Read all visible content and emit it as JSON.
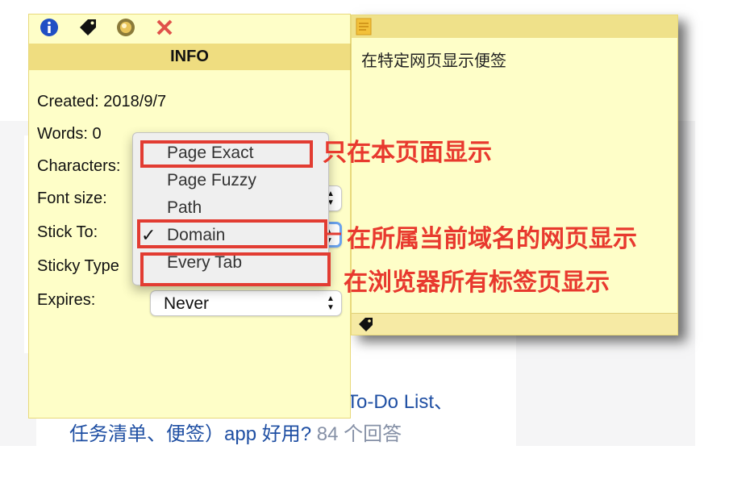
{
  "background": {
    "line1": "To-Do List、",
    "line2_main": "任务清单、便签）app 好用?",
    "line2_count": "84 个回答"
  },
  "note": {
    "text": "在特定网页显示便签"
  },
  "info_panel": {
    "header": "INFO",
    "created": "Created: 2018/9/7",
    "words": "Words: 0",
    "characters": "Characters:",
    "font_size_label": "Font size:",
    "stick_to_label": "Stick To:",
    "sticky_type_label": "Sticky Type",
    "expires_label": "Expires:",
    "expires_value": "Never"
  },
  "dropdown": {
    "options": [
      "Page Exact",
      "Page Fuzzy",
      "Path",
      "Domain",
      "Every Tab"
    ],
    "selected": "Domain"
  },
  "annotations": {
    "page_exact": "只在本页面显示",
    "domain": "在所属当前域名的网页显示",
    "every_tab": "在浏览器所有标签页显示"
  },
  "colors": {
    "note_bg": "#fefec8",
    "header_bg": "#efdd80",
    "annotation_red": "#e23c32",
    "link_blue": "#1f4fa3"
  }
}
